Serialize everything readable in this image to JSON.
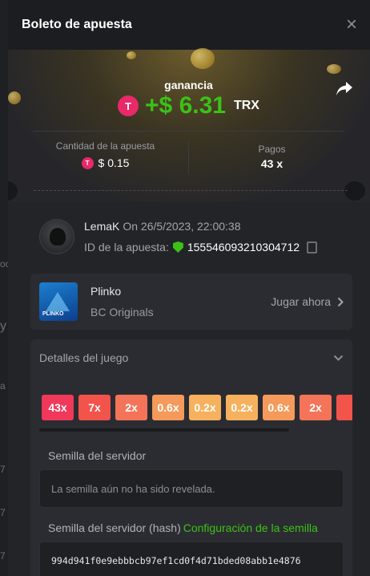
{
  "modal": {
    "title": "Boleto de apuesta",
    "close_icon": "×"
  },
  "backdrop_edge": [
    "oc",
    "y",
    "a",
    "7",
    "7",
    "7"
  ],
  "win": {
    "label": "ganancia",
    "amount": "+$ 6.31",
    "currency": "TRX",
    "coin_glyph": "T"
  },
  "stats": {
    "bet_label": "Cantidad de la apuesta",
    "bet_value": "$ 0.15",
    "payout_label": "Pagos",
    "payout_value": "43 x"
  },
  "user": {
    "name": "LemaK",
    "time": "On 26/5/2023, 22:00:38",
    "bet_id_label": "ID de la apuesta:",
    "bet_id": "155546093210304712"
  },
  "game": {
    "name": "Plinko",
    "provider": "BC Originals",
    "play_label": "Jugar ahora",
    "thumb_text": "PLINKO"
  },
  "details": {
    "title": "Detalles del juego",
    "multipliers": [
      {
        "label": "43x",
        "color": "#f0385a"
      },
      {
        "label": "7x",
        "color": "#f2534b"
      },
      {
        "label": "2x",
        "color": "#f4745a"
      },
      {
        "label": "0.6x",
        "color": "#f59a5a"
      },
      {
        "label": "0.2x",
        "color": "#f7b15e"
      },
      {
        "label": "0.2x",
        "color": "#f7b15e"
      },
      {
        "label": "0.6x",
        "color": "#f59a5a"
      },
      {
        "label": "2x",
        "color": "#f4745a"
      },
      {
        "label": "",
        "color": "#f2534b"
      }
    ],
    "server_seed_label": "Semilla del servidor",
    "server_seed_value": "La semilla aún no ha sido revelada.",
    "server_hash_label": "Semilla del servidor (hash)",
    "seed_config_link": "Configuración de la semilla",
    "server_hash_value": "994d941f0e9ebbbcb97ef1cd0f4d71bded08abb1e4876"
  }
}
